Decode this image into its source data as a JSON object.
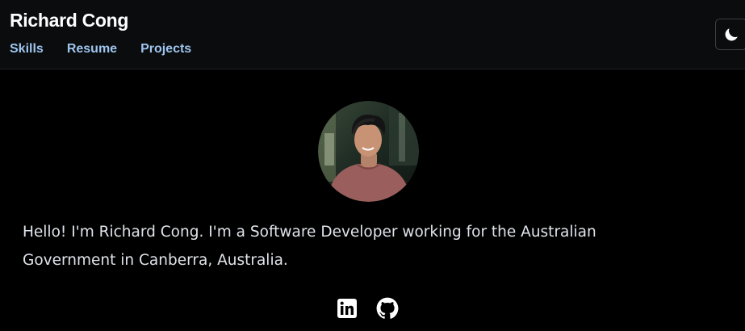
{
  "header": {
    "title": "Richard Cong",
    "nav": [
      {
        "label": "Skills"
      },
      {
        "label": "Resume"
      },
      {
        "label": "Projects"
      }
    ],
    "theme_toggle_icon": "moon-icon"
  },
  "main": {
    "avatar_icon": "profile-photo",
    "intro": "Hello! I'm Richard Cong. I'm a Software Developer working for the Australian Government in Canberra, Australia.",
    "social": [
      {
        "icon": "linkedin-icon"
      },
      {
        "icon": "github-icon"
      }
    ]
  },
  "colors": {
    "background": "#000000",
    "header_background": "#0b0c0e",
    "nav_link": "#9ec5ee",
    "text": "#dfe3ea"
  }
}
